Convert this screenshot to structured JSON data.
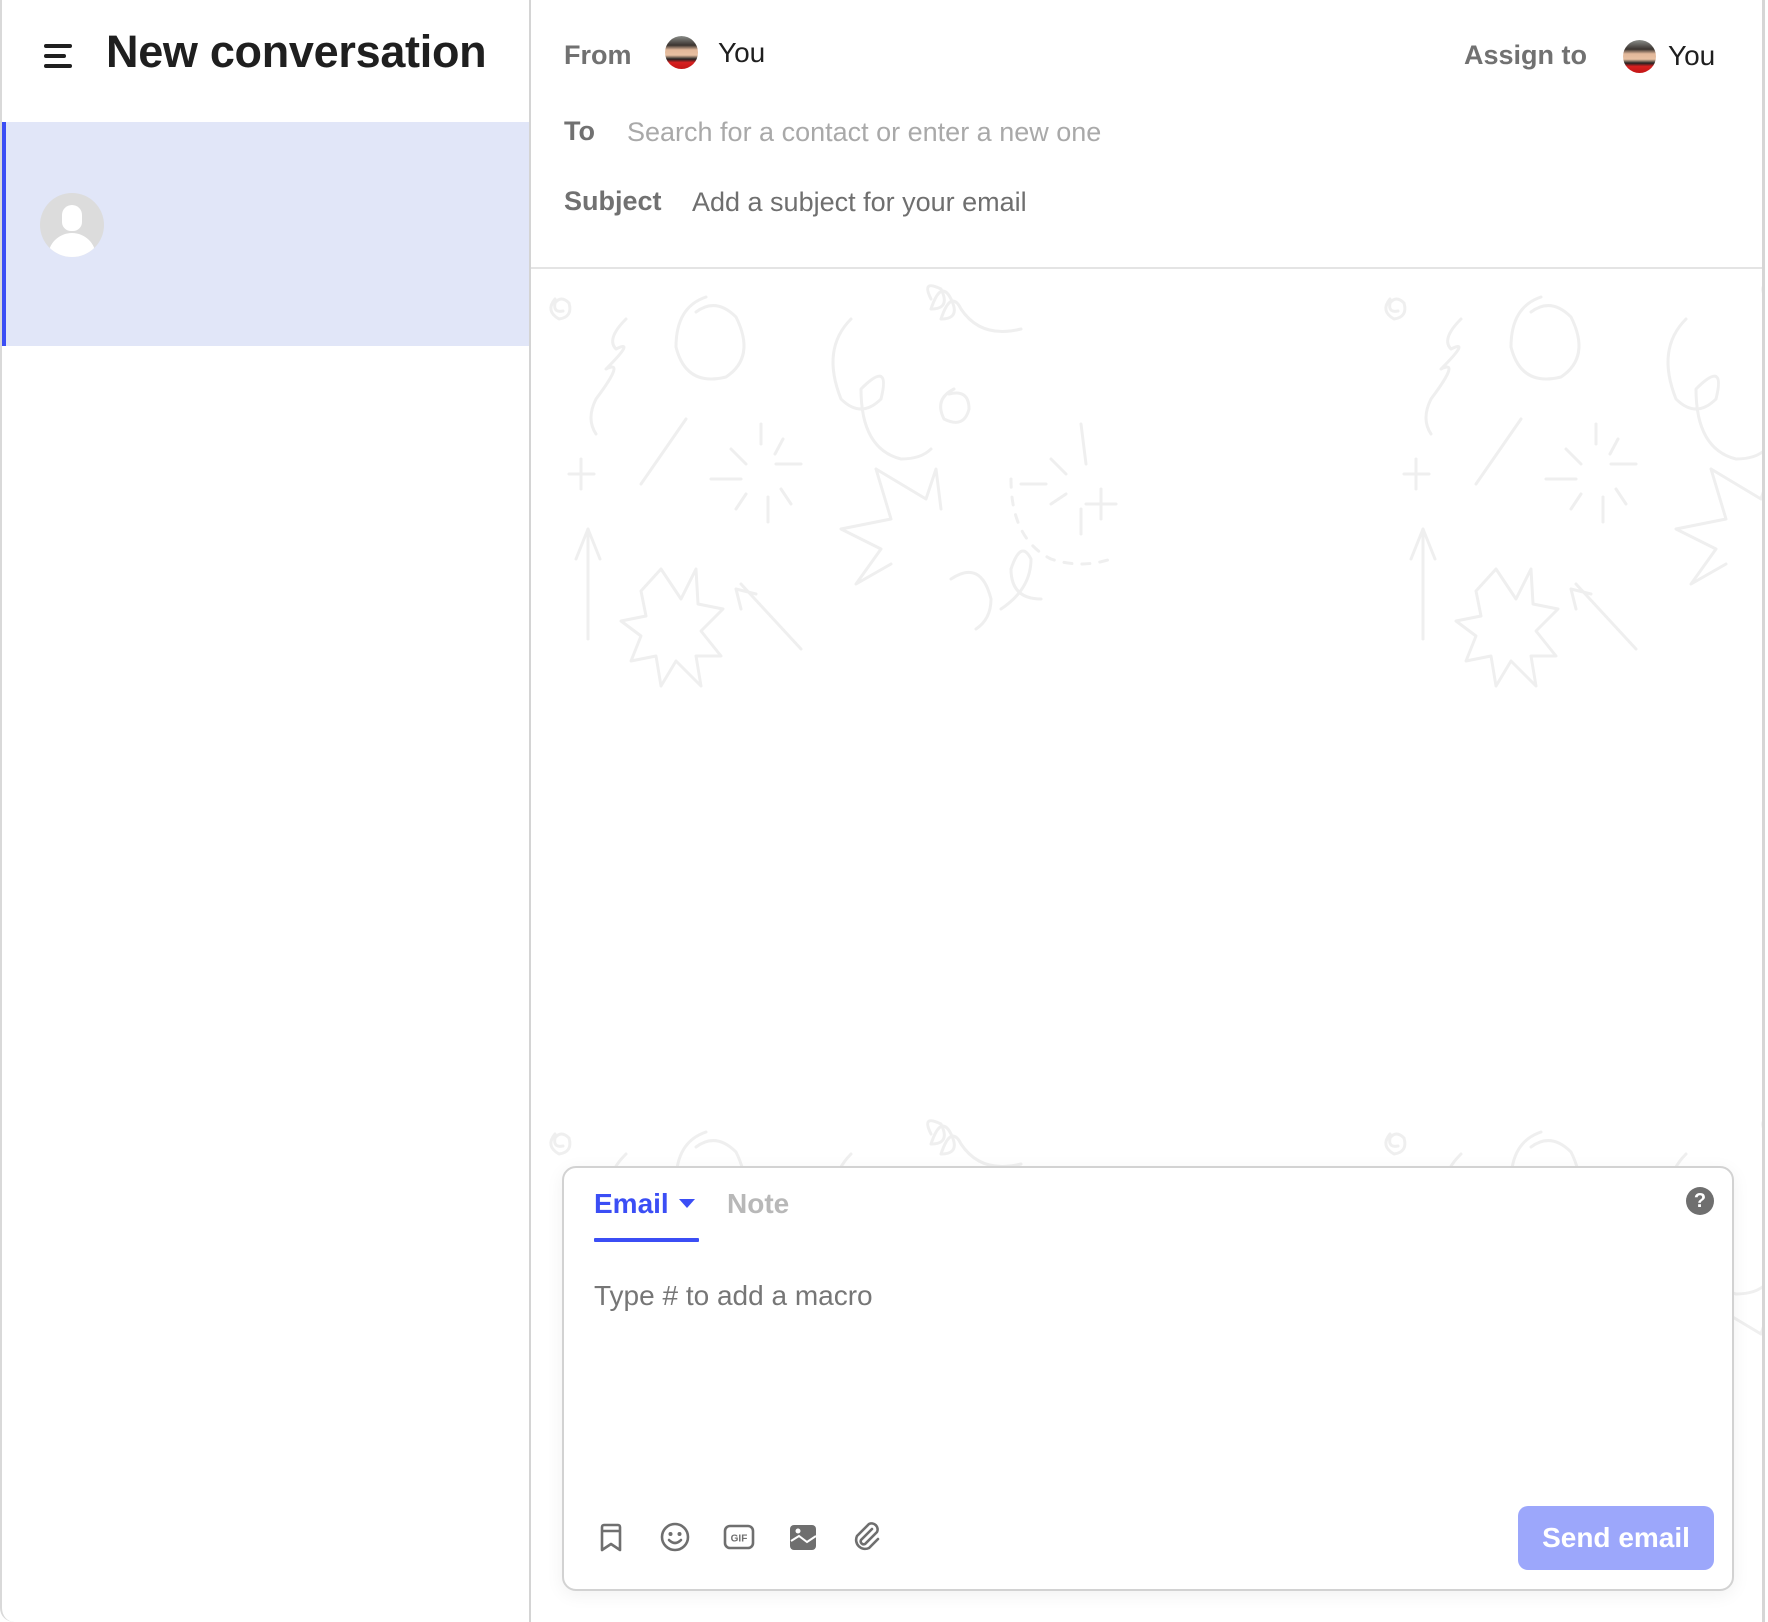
{
  "sidebar": {
    "menu_icon": "hamburger-menu-icon",
    "title": "New conversation",
    "conversations": [
      {
        "avatar_icon": "default-user-avatar-icon",
        "selected": true
      }
    ]
  },
  "header": {
    "from_label": "From",
    "from_user": "You",
    "assign_label": "Assign to",
    "assign_user": "You",
    "to_label": "To",
    "to_placeholder": "Search for a contact or enter a new one",
    "to_value": "",
    "subject_label": "Subject",
    "subject_placeholder": "Add a subject for your email",
    "subject_value": ""
  },
  "composer": {
    "tabs": [
      {
        "label": "Email",
        "active": true,
        "has_dropdown": true
      },
      {
        "label": "Note",
        "active": false
      }
    ],
    "help_icon": "question-mark-icon",
    "help_glyph": "?",
    "reply_placeholder": "Type # to add a macro",
    "reply_value": "",
    "toolbar": [
      {
        "icon": "bookmark-icon",
        "label": "Macros"
      },
      {
        "icon": "emoji-icon",
        "label": "Emoji"
      },
      {
        "icon": "gif-icon",
        "label": "GIF"
      },
      {
        "icon": "image-icon",
        "label": "Image"
      },
      {
        "icon": "paperclip-icon",
        "label": "Attachment"
      }
    ],
    "send_label": "Send email"
  },
  "colors": {
    "accent": "#3b4ef5",
    "selected_row_bg": "#e1e6f8",
    "send_button_disabled": "#9ca7fb",
    "label_grey": "#717171",
    "placeholder_grey": "#a9a9a9"
  }
}
